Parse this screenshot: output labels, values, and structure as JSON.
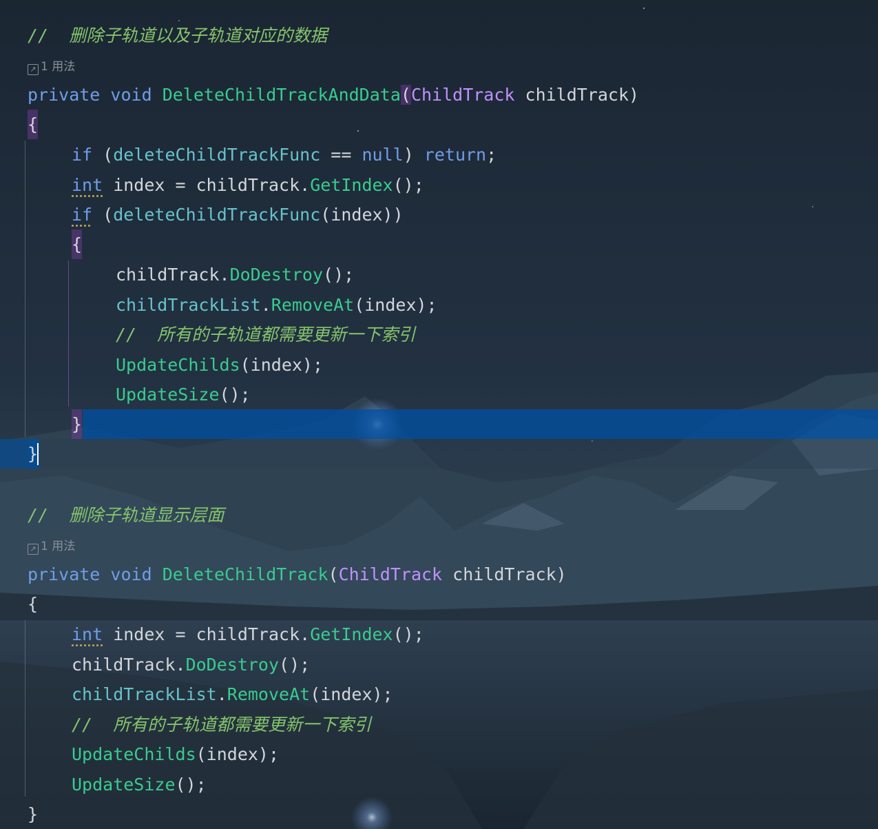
{
  "colors": {
    "keyword": "#6f9ee8",
    "function": "#39cc8f",
    "type": "#c191ff",
    "field": "#66c3cc",
    "comment": "#85c46c",
    "plain": "#d3d6db",
    "selection": "#004ea0"
  },
  "usage_icon": "usage-link-icon",
  "block1": {
    "comment": "//  删除子轨道以及子轨道对应的数据",
    "usage": "1 用法",
    "sig_private": "private",
    "sig_void": "void",
    "sig_name": "DeleteChildTrackAndData",
    "sig_open": "(",
    "sig_type": "ChildTrack",
    "sig_param": " childTrack)",
    "open_brace": "{",
    "l1_if": "if",
    "l1_open": " (",
    "l1_field": "deleteChildTrackFunc",
    "l1_eq": " == ",
    "l1_null": "null",
    "l1_close": ") ",
    "l1_return": "return",
    "l1_semi": ";",
    "l2_int": "int",
    "l2_mid": " index = childTrack.",
    "l2_fn": "GetIndex",
    "l2_end": "();",
    "l3_if": "if",
    "l3_open": " (",
    "l3_field": "deleteChildTrackFunc",
    "l3_end": "(index))",
    "inner_open": "{",
    "l4_obj": "childTrack.",
    "l4_fn": "DoDestroy",
    "l4_end": "();",
    "l5_field": "childTrackList",
    "l5_dot": ".",
    "l5_fn": "RemoveAt",
    "l5_end": "(index);",
    "l6_comment": "//  所有的子轨道都需要更新一下索引",
    "l7_fn": "UpdateChilds",
    "l7_end": "(index);",
    "l8_fn": "UpdateSize",
    "l8_end": "();",
    "inner_close": "}",
    "close_brace": "}"
  },
  "block2": {
    "comment": "//  删除子轨道显示层面",
    "usage": "1 用法",
    "sig_private": "private",
    "sig_void": "void",
    "sig_name": "DeleteChildTrack",
    "sig_open": "(",
    "sig_type": "ChildTrack",
    "sig_param": " childTrack)",
    "open_brace": "{",
    "l1_int": "int",
    "l1_mid": " index = childTrack.",
    "l1_fn": "GetIndex",
    "l1_end": "();",
    "l2_obj": "childTrack.",
    "l2_fn": "DoDestroy",
    "l2_end": "();",
    "l3_field": "childTrackList",
    "l3_dot": ".",
    "l3_fn": "RemoveAt",
    "l3_end": "(index);",
    "l4_comment": "//  所有的子轨道都需要更新一下索引",
    "l5_fn": "UpdateChilds",
    "l5_end": "(index);",
    "l6_fn": "UpdateSize",
    "l6_end": "();",
    "close_brace": "}"
  }
}
